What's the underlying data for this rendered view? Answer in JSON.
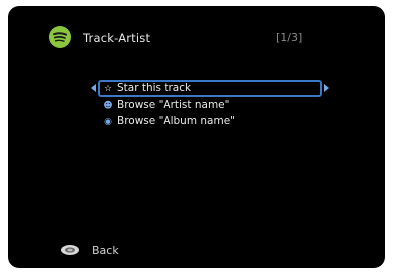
{
  "header": {
    "title": "Track-Artist",
    "page_indicator": "[1/3]",
    "logo_icon": "spotify-logo-icon",
    "logo_color": "#8cc63f"
  },
  "menu": {
    "items": [
      {
        "label": "Star this track",
        "icon": "star-icon",
        "selected": true
      },
      {
        "label": "Browse \"Artist name\"",
        "icon": "person-icon",
        "selected": false
      },
      {
        "label": "Browse \"Album name\"",
        "icon": "disc-icon",
        "selected": false
      }
    ],
    "selection_color": "#3b78c6"
  },
  "footer": {
    "back_label": "Back",
    "back_icon": "remote-back-button-icon"
  }
}
